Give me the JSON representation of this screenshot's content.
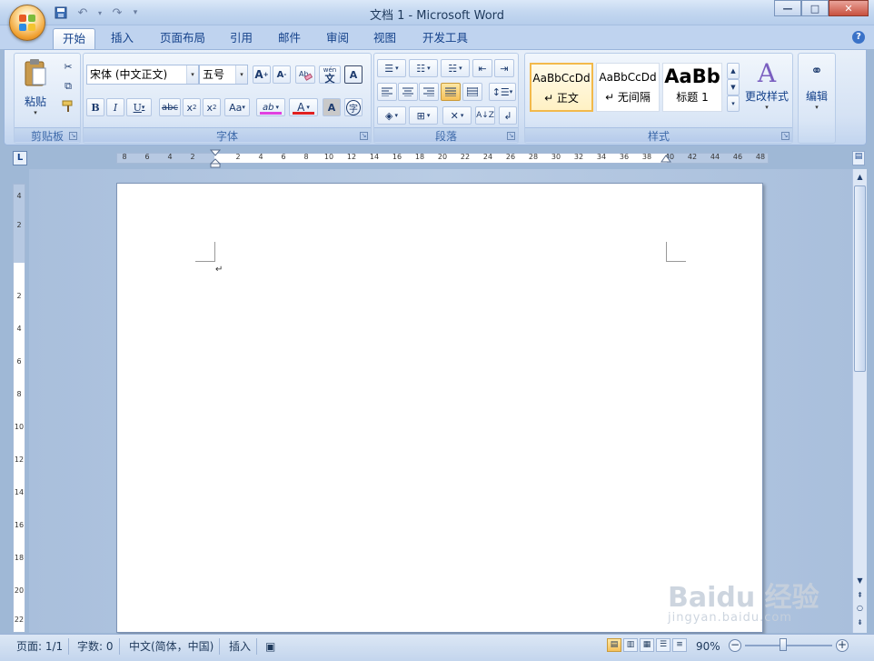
{
  "window": {
    "title": "文档 1 - Microsoft Word",
    "controls": {
      "minimize": "—",
      "maximize": "□",
      "close": "✕"
    }
  },
  "qat": {
    "save_icon": "save-icon",
    "undo_icon": "undo-icon",
    "redo_icon": "redo-icon",
    "customize": "▾"
  },
  "tabs": [
    {
      "label": "开始",
      "active": true
    },
    {
      "label": "插入"
    },
    {
      "label": "页面布局"
    },
    {
      "label": "引用"
    },
    {
      "label": "邮件"
    },
    {
      "label": "审阅"
    },
    {
      "label": "视图"
    },
    {
      "label": "开发工具"
    }
  ],
  "help": "?",
  "ribbon": {
    "clipboard": {
      "label": "剪贴板",
      "paste_label": "粘贴"
    },
    "font": {
      "label": "字体",
      "font_name": "宋体 (中文正文)",
      "font_size": "五号",
      "phonetic": "wén",
      "char_border": "A",
      "char_shading": "A",
      "enclose": "字",
      "change_case": "Aa"
    },
    "paragraph": {
      "label": "段落"
    },
    "styles": {
      "label": "样式",
      "items": [
        {
          "sample": "AaBbCcDd",
          "name": "↵ 正文",
          "selected": true
        },
        {
          "sample": "AaBbCcDd",
          "name": "↵ 无间隔"
        },
        {
          "sample": "AaBb",
          "name": "标题 1"
        }
      ],
      "change_styles": "更改样式"
    },
    "editing": {
      "label": "编辑"
    }
  },
  "ruler": {
    "tab_selector": "L",
    "h_left": [
      "8",
      "6",
      "4",
      "2"
    ],
    "h_right": [
      "2",
      "4",
      "6",
      "8",
      "10",
      "12",
      "14",
      "16",
      "18",
      "20",
      "22",
      "24",
      "26",
      "28",
      "30",
      "32",
      "34",
      "36",
      "38",
      "40",
      "42",
      "44",
      "46",
      "48"
    ],
    "v_top": [
      "4",
      "2"
    ],
    "v_body": [
      "2",
      "4",
      "6",
      "8",
      "10",
      "12",
      "14",
      "16",
      "18",
      "20",
      "22"
    ]
  },
  "document": {
    "para_mark": "↵"
  },
  "statusbar": {
    "page": "页面: 1/1",
    "words": "字数: 0",
    "language": "中文(简体，中国)",
    "mode": "插入",
    "zoom": "90%"
  },
  "watermark": {
    "logo": "Baidu 经验",
    "url": "jingyan.baidu.com"
  }
}
